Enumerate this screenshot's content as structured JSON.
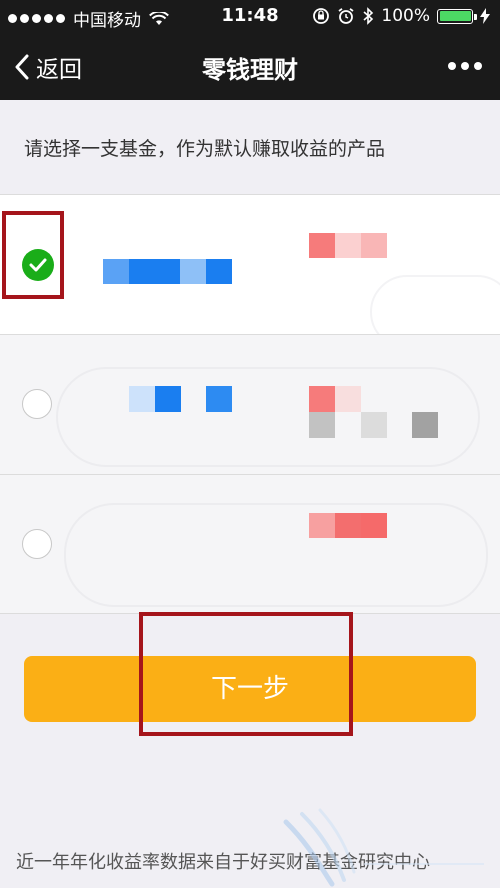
{
  "status_bar": {
    "carrier": "中国移动",
    "time": "11:48",
    "battery": "100%",
    "battery_level": 1.0,
    "icons": [
      "signal-dots",
      "wifi-icon",
      "rotation-lock-icon",
      "alarm-icon",
      "bluetooth-icon",
      "battery-icon",
      "charging-icon"
    ]
  },
  "nav": {
    "back_label": "返回",
    "title": "零钱理财",
    "more_icon": "more-icon"
  },
  "prompt": "请选择一支基金，作为默认赚取收益的产品",
  "funds": [
    {
      "selected": true
    },
    {
      "selected": false
    },
    {
      "selected": false
    }
  ],
  "next_button": "下一步",
  "footer_note": "近一年年化收益率数据来自于好买财富基金研究中心",
  "colors": {
    "accent": "#fbaf15",
    "check": "#1aad19",
    "highlight": "#a5151b",
    "nav_bg": "#1a1a1a"
  }
}
